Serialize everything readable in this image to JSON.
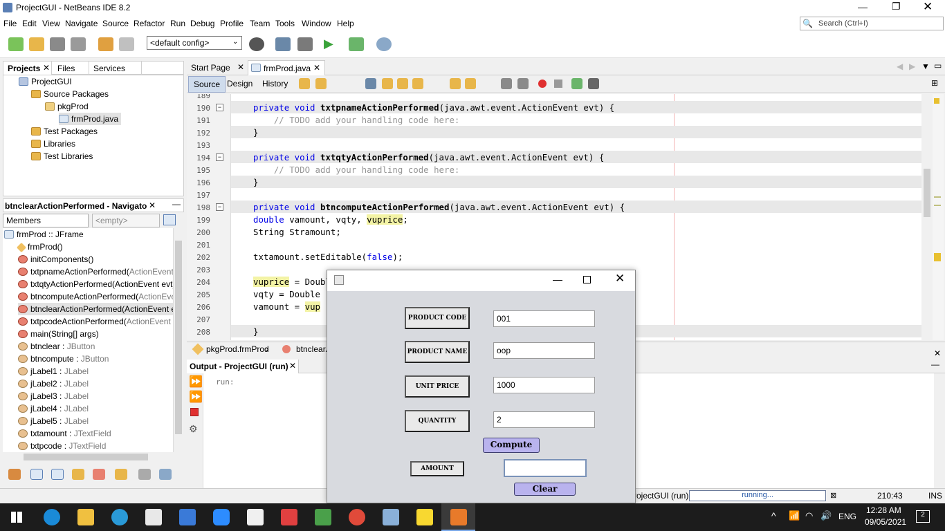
{
  "window": {
    "title": "ProjectGUI - NetBeans IDE 8.2"
  },
  "menu": [
    "File",
    "Edit",
    "View",
    "Navigate",
    "Source",
    "Refactor",
    "Run",
    "Debug",
    "Profile",
    "Team",
    "Tools",
    "Window",
    "Help"
  ],
  "search": {
    "placeholder": "Search (Ctrl+I)"
  },
  "toolbar": {
    "config": "<default config>"
  },
  "projects_panel": {
    "tabs": [
      "Projects",
      "Files",
      "Services"
    ],
    "tree": [
      "ProjectGUI",
      "Source Packages",
      "pkgProd",
      "frmProd.java",
      "Test Packages",
      "Libraries",
      "Test Libraries"
    ]
  },
  "navigator": {
    "title": "btnclearActionPerformed - Navigator",
    "filter": "Members",
    "filter2": "<empty>",
    "root": "frmProd :: JFrame",
    "items": [
      {
        "name": "frmProd()",
        "type": ""
      },
      {
        "name": "initComponents()",
        "type": ""
      },
      {
        "name": "txtpnameActionPerformed(",
        "type": "ActionEvent ev"
      },
      {
        "name": "txtqtyActionPerformed(",
        "type": "ActionEvent evt)"
      },
      {
        "name": "btncomputeActionPerformed(",
        "type": "ActionEvent"
      },
      {
        "name": "btnclearActionPerformed(ActionEvent evt",
        "type": ""
      },
      {
        "name": "txtpcodeActionPerformed(",
        "type": "ActionEvent ev"
      },
      {
        "name": "main(String[] args)",
        "type": ""
      },
      {
        "name": "btnclear : ",
        "type": "JButton"
      },
      {
        "name": "btncompute : ",
        "type": "JButton"
      },
      {
        "name": "jLabel1 : ",
        "type": "JLabel"
      },
      {
        "name": "jLabel2 : ",
        "type": "JLabel"
      },
      {
        "name": "jLabel3 : ",
        "type": "JLabel"
      },
      {
        "name": "jLabel4 : ",
        "type": "JLabel"
      },
      {
        "name": "jLabel5 : ",
        "type": "JLabel"
      },
      {
        "name": "txtamount : ",
        "type": "JTextField"
      },
      {
        "name": "txtpcode : ",
        "type": "JTextField"
      }
    ]
  },
  "editor": {
    "tabs": [
      "Start Page",
      "frmProd.java"
    ],
    "subtabs": [
      "Source",
      "Design",
      "History"
    ],
    "lines": [
      {
        "n": "189",
        "code": ""
      },
      {
        "n": "190",
        "code": "private void txtpnameActionPerformed(java.awt.event.ActionEvent evt) {"
      },
      {
        "n": "191",
        "code": "    // TODO add your handling code here:"
      },
      {
        "n": "192",
        "code": "}"
      },
      {
        "n": "193",
        "code": ""
      },
      {
        "n": "194",
        "code": "private void txtqtyActionPerformed(java.awt.event.ActionEvent evt) {"
      },
      {
        "n": "195",
        "code": "    // TODO add your handling code here:"
      },
      {
        "n": "196",
        "code": "}"
      },
      {
        "n": "197",
        "code": ""
      },
      {
        "n": "198",
        "code": "private void btncomputeActionPerformed(java.awt.event.ActionEvent evt) {"
      },
      {
        "n": "199",
        "code": "double vamount, vqty, vuprice;"
      },
      {
        "n": "200",
        "code": "String Stramount;"
      },
      {
        "n": "201",
        "code": ""
      },
      {
        "n": "202",
        "code": "txtamount.setEditable(false);"
      },
      {
        "n": "203",
        "code": ""
      },
      {
        "n": "204",
        "code": "vuprice = Doubl"
      },
      {
        "n": "205",
        "code": "vqty = Double"
      },
      {
        "n": "206",
        "code": "vamount = vup"
      },
      {
        "n": "207",
        "code": ""
      },
      {
        "n": "208",
        "code": "}"
      }
    ],
    "breadcrumbs": [
      "pkgProd.frmProd",
      "btnclearA"
    ]
  },
  "output": {
    "title": "Output - ProjectGUI (run)",
    "text": "run:"
  },
  "status": {
    "project": "rojectGUI (run)",
    "progress": "running...",
    "position": "210:43",
    "mode": "INS"
  },
  "dialog": {
    "labels": [
      "PRODUCT CODE",
      "PRODUCT NAME",
      "UNIT PRICE",
      "QUANTITY",
      "AMOUNT"
    ],
    "values": [
      "001",
      "oop",
      "1000",
      "2",
      ""
    ],
    "compute": "Compute",
    "clear": "Clear"
  },
  "taskbar": {
    "lang": "ENG",
    "time": "12:28 AM",
    "date": "09/05/2021",
    "notifications": "2"
  }
}
